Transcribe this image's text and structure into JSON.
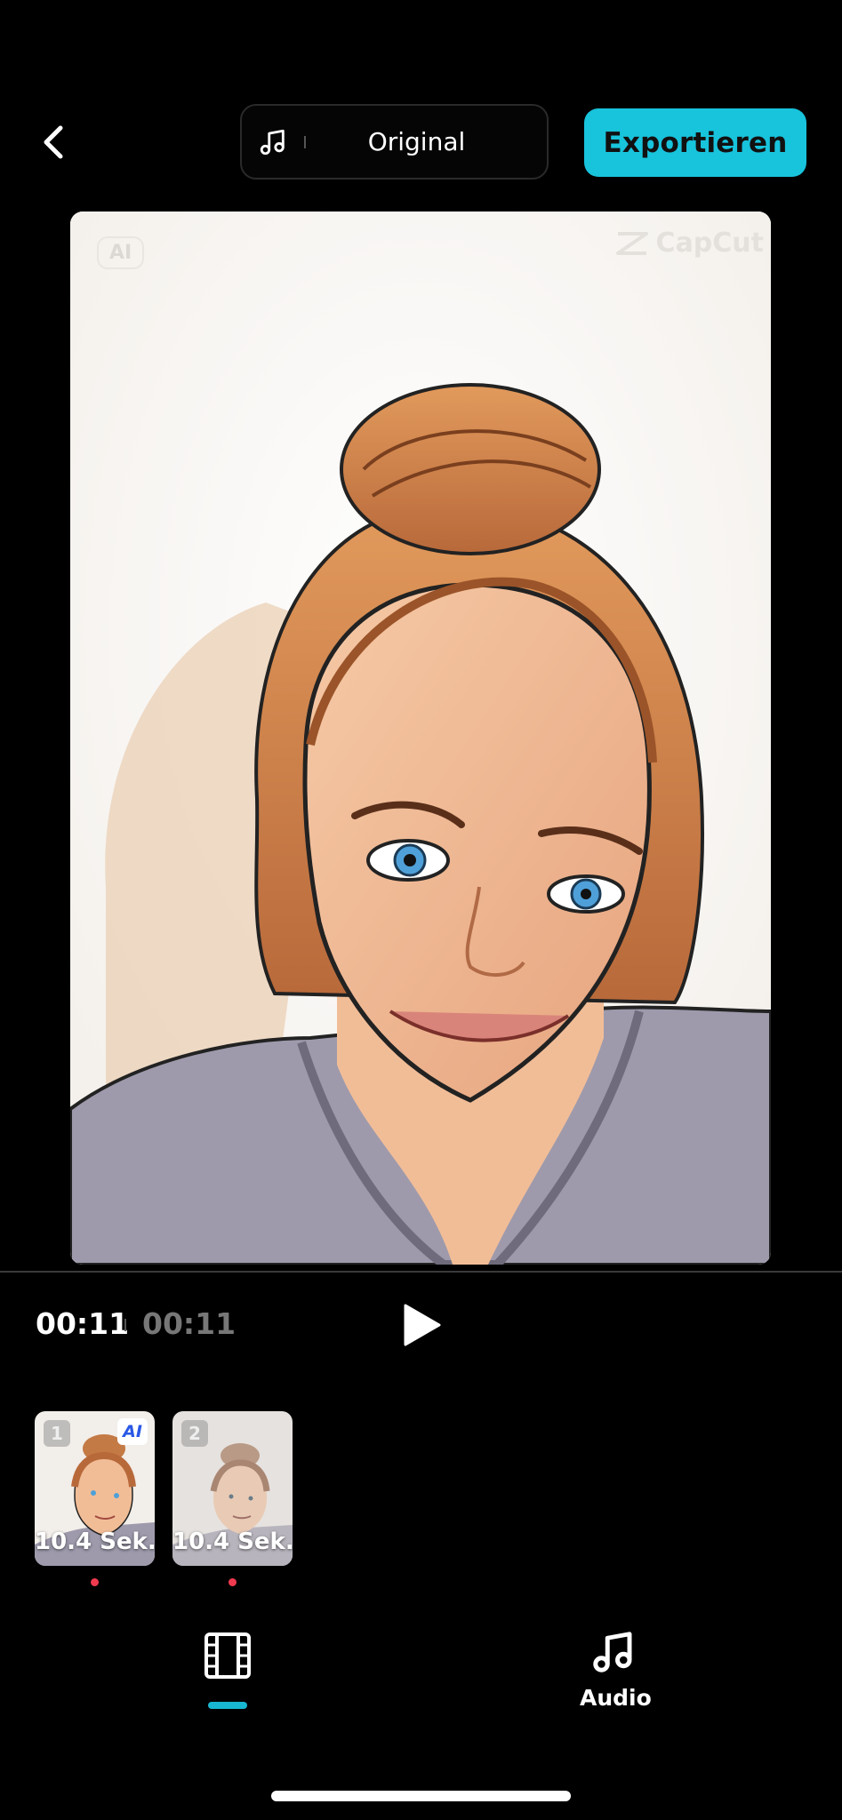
{
  "header": {
    "music_label": "Original",
    "export_label": "Exportieren"
  },
  "preview": {
    "ai_tag": "AI",
    "watermark": "CapCut"
  },
  "playback": {
    "current_time": "00:11",
    "total_time": "00:11"
  },
  "clips": [
    {
      "number": "1",
      "duration": "10.4 Sek.",
      "badge": "AI"
    },
    {
      "number": "2",
      "duration": "10.4 Sek."
    }
  ],
  "tabs": {
    "audio_label": "Audio"
  },
  "colors": {
    "accent": "#18c3dc",
    "clip_marker": "#f23a4f",
    "background": "#000000"
  }
}
